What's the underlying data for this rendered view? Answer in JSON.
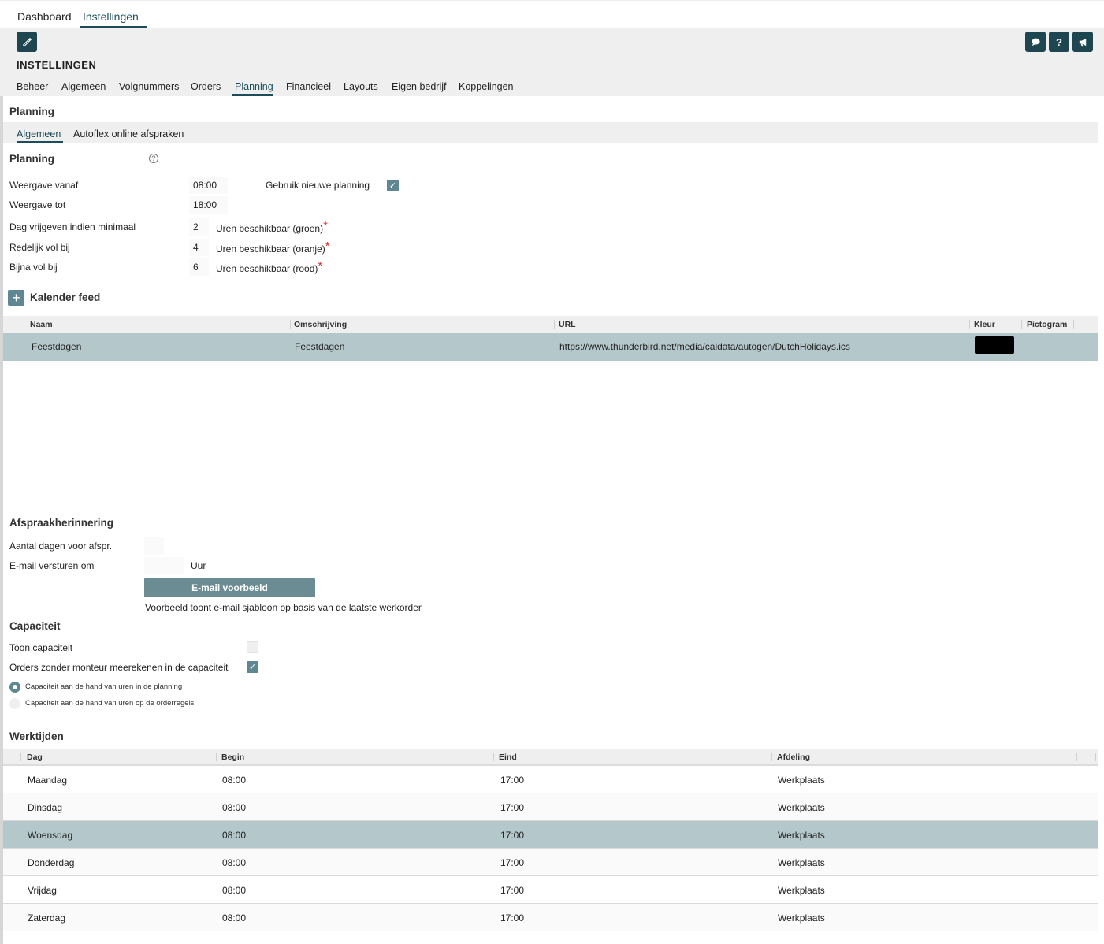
{
  "topnav": {
    "tabs": [
      "Dashboard",
      "Instellingen"
    ],
    "active": "Instellingen"
  },
  "header": {
    "title": "INSTELLINGEN",
    "tabs": [
      "Beheer",
      "Algemeen",
      "Volgnummers",
      "Orders",
      "Planning",
      "Financieel",
      "Layouts",
      "Eigen bedrijf",
      "Koppelingen"
    ],
    "active_tab": "Planning",
    "icons": [
      "pencil-icon",
      "chat-icon",
      "help-icon",
      "megaphone-icon"
    ],
    "help_glyph": "?"
  },
  "page": {
    "section_title": "Planning",
    "subtabs": [
      "Algemeen",
      "Autoflex online afspraken"
    ],
    "active_subtab": "Algemeen"
  },
  "planning": {
    "title": "Planning",
    "help_glyph": "?",
    "weergave_vanaf_label": "Weergave vanaf",
    "weergave_vanaf_value": "08:00",
    "weergave_tot_label": "Weergave tot",
    "weergave_tot_value": "18:00",
    "nieuwe_planning_label": "Gebruik nieuwe planning",
    "nieuwe_planning_checked": true,
    "dag_vrijgeven_label": "Dag vrijgeven indien minimaal",
    "dag_vrijgeven_value": "2",
    "dag_vrijgeven_unit": "Uren beschikbaar (groen)",
    "redelijk_vol_label": "Redelijk vol bij",
    "redelijk_vol_value": "4",
    "redelijk_vol_unit": "Uren beschikbaar (oranje)",
    "bijna_vol_label": "Bijna vol bij",
    "bijna_vol_value": "6",
    "bijna_vol_unit": "Uren beschikbaar (rood)",
    "required_mark": "*"
  },
  "kalender_feed": {
    "title": "Kalender feed",
    "add_glyph": "+",
    "columns": [
      "Naam",
      "Omschrijving",
      "URL",
      "Kleur",
      "Pictogram"
    ],
    "rows": [
      {
        "naam": "Feestdagen",
        "omschrijving": "Feestdagen",
        "url": "https://www.thunderbird.net/media/caldata/autogen/DutchHolidays.ics",
        "kleur": "#000000"
      }
    ]
  },
  "afspraakherinnering": {
    "title": "Afspraakherinnering",
    "aantal_dagen_label": "Aantal dagen voor afspr.",
    "aantal_dagen_value": "",
    "email_om_label": "E-mail versturen om",
    "email_om_value": "",
    "email_om_unit": "Uur",
    "button_label": "E-mail voorbeeld",
    "note": "Voorbeeld toont e-mail sjabloon op basis van de laatste werkorder"
  },
  "capaciteit": {
    "title": "Capaciteit",
    "toon_label": "Toon capaciteit",
    "toon_checked": false,
    "zonder_monteur_label": "Orders zonder monteur meerekenen in de capaciteit",
    "zonder_monteur_checked": true,
    "radio_options": [
      "Capaciteit aan de hand van uren in de planning",
      "Capaciteit aan de hand van uren op de orderregels"
    ],
    "radio_selected": 0
  },
  "werktijden": {
    "title": "Werktijden",
    "columns": [
      "Dag",
      "Begin",
      "Eind",
      "Afdeling"
    ],
    "rows": [
      {
        "dag": "Maandag",
        "begin": "08:00",
        "eind": "17:00",
        "afdeling": "Werkplaats"
      },
      {
        "dag": "Dinsdag",
        "begin": "08:00",
        "eind": "17:00",
        "afdeling": "Werkplaats"
      },
      {
        "dag": "Woensdag",
        "begin": "08:00",
        "eind": "17:00",
        "afdeling": "Werkplaats"
      },
      {
        "dag": "Donderdag",
        "begin": "08:00",
        "eind": "17:00",
        "afdeling": "Werkplaats"
      },
      {
        "dag": "Vrijdag",
        "begin": "08:00",
        "eind": "17:00",
        "afdeling": "Werkplaats"
      },
      {
        "dag": "Zaterdag",
        "begin": "08:00",
        "eind": "17:00",
        "afdeling": "Werkplaats"
      }
    ],
    "selected_row": 2
  },
  "colors": {
    "accent_dark": "#1e4650",
    "accent": "#5e8792",
    "selected_row": "#b4c8cb",
    "required": "#d32f2f"
  }
}
